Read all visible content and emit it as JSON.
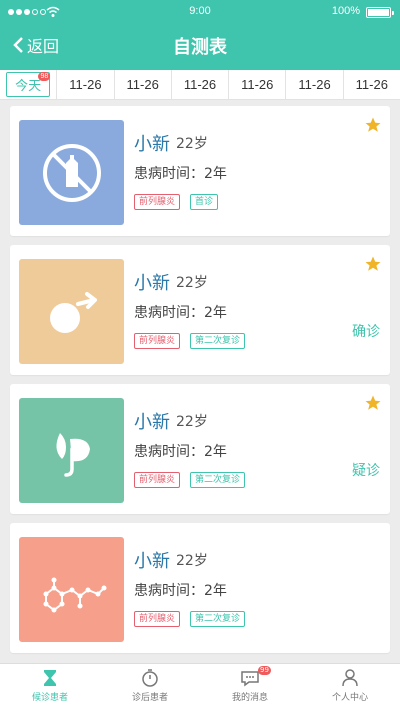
{
  "status_bar": {
    "time": "9:00",
    "battery": "100%"
  },
  "nav": {
    "back_label": "返回",
    "title": "自测表"
  },
  "tabs": [
    {
      "label": "今天",
      "badge": "98",
      "active": true
    },
    {
      "label": "11-26"
    },
    {
      "label": "11-26"
    },
    {
      "label": "11-26"
    },
    {
      "label": "11-26"
    },
    {
      "label": "11-26"
    },
    {
      "label": "11-26"
    }
  ],
  "cards": [
    {
      "name": "小新",
      "age": "22岁",
      "duration": "患病时间：2年",
      "tags": [
        "前列腺炎",
        "首诊"
      ],
      "starred": true,
      "status": "",
      "thumb_color": "#8aa9dd",
      "icon": "no-bottle-icon"
    },
    {
      "name": "小新",
      "age": "22岁",
      "duration": "患病时间：2年",
      "tags": [
        "前列腺炎",
        "第二次复诊"
      ],
      "starred": true,
      "status": "确诊",
      "thumb_color": "#f0cb9a",
      "icon": "male-symbol-icon"
    },
    {
      "name": "小新",
      "age": "22岁",
      "duration": "患病时间：2年",
      "tags": [
        "前列腺炎",
        "第二次复诊"
      ],
      "starred": true,
      "status": "疑诊",
      "thumb_color": "#76c4a8",
      "icon": "leaf-icon"
    },
    {
      "name": "小新",
      "age": "22岁",
      "duration": "患病时间：2年",
      "tags": [
        "前列腺炎",
        "第二次复诊"
      ],
      "starred": false,
      "status": "",
      "thumb_color": "#f6a08c",
      "icon": "molecule-icon"
    }
  ],
  "bottom_nav": [
    {
      "label": "候诊患者",
      "icon": "hourglass-icon",
      "active": true
    },
    {
      "label": "诊后患者",
      "icon": "timer-icon",
      "active": false
    },
    {
      "label": "我的消息",
      "icon": "message-icon",
      "active": false,
      "badge": "99"
    },
    {
      "label": "个人中心",
      "icon": "person-icon",
      "active": false
    }
  ],
  "colors": {
    "accent": "#3fc4ad",
    "name": "#2a78a9",
    "tag_red": "#e5606f",
    "star": "#f0b429",
    "badge": "#f05a5a"
  }
}
